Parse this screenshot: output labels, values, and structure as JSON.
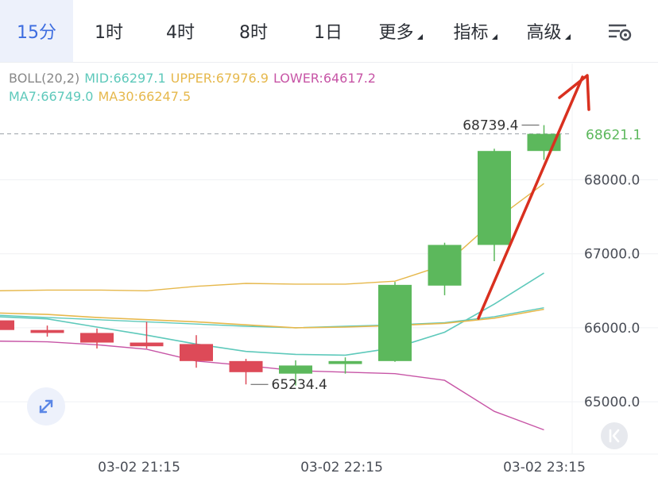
{
  "tabs": [
    {
      "label": "15分",
      "active": true
    },
    {
      "label": "1时"
    },
    {
      "label": "4时"
    },
    {
      "label": "8时"
    },
    {
      "label": "1日"
    },
    {
      "label": "更多",
      "dropdown": true
    },
    {
      "label": "指标",
      "dropdown": true
    },
    {
      "label": "高级",
      "dropdown": true
    }
  ],
  "settings_icon": "chart-settings-icon",
  "legend": {
    "boll_label": "BOLL(20,2)",
    "mid": "MID:66297.1",
    "upper": "UPPER:67976.9",
    "lower": "LOWER:64617.2",
    "ma7": "MA7:66749.0",
    "ma30": "MA30:66247.5"
  },
  "colors": {
    "up": "#5cb85c",
    "down": "#dd4a58",
    "boll_mid": "#5ec9bb",
    "boll_upper": "#e6b84c",
    "boll_lower": "#c755a6",
    "ma7": "#5ec9bb",
    "ma30": "#e6b84c",
    "arrow": "#d9301f",
    "active_tab": "#3d6de0"
  },
  "chart_data": {
    "type": "candlestick",
    "ylim": [
      64400,
      68950
    ],
    "y_ticks": [
      65000,
      66000,
      67000,
      68000
    ],
    "y_tick_labels": [
      "65000.0",
      "66000.0",
      "67000.0",
      "68000.0"
    ],
    "x_tick_labels": [
      "03-02 21:15",
      "03-02 22:15",
      "03-02 23:15"
    ],
    "candles": [
      {
        "open": 66100,
        "high": 66150,
        "low": 65950,
        "close": 65970
      },
      {
        "open": 65970,
        "high": 66030,
        "low": 65880,
        "close": 65930
      },
      {
        "open": 65930,
        "high": 65990,
        "low": 65720,
        "close": 65800
      },
      {
        "open": 65800,
        "high": 66080,
        "low": 65720,
        "close": 65750
      },
      {
        "open": 65780,
        "high": 65900,
        "low": 65460,
        "close": 65550
      },
      {
        "open": 65550,
        "high": 65580,
        "low": 65234.4,
        "close": 65400
      },
      {
        "open": 65380,
        "high": 65560,
        "low": 65220,
        "close": 65490
      },
      {
        "open": 65510,
        "high": 65600,
        "low": 65380,
        "close": 65550
      },
      {
        "open": 65550,
        "high": 66620,
        "low": 65540,
        "close": 66580
      },
      {
        "open": 66570,
        "high": 67150,
        "low": 66440,
        "close": 67120
      },
      {
        "open": 67120,
        "high": 68420,
        "low": 66900,
        "close": 68390
      },
      {
        "open": 68390,
        "high": 68739.4,
        "low": 68270,
        "close": 68621.1
      }
    ],
    "series": [
      {
        "name": "UPPER",
        "values": [
          66500,
          66510,
          66510,
          66500,
          66560,
          66600,
          66590,
          66590,
          66630,
          66850,
          67450,
          67950
        ]
      },
      {
        "name": "MID",
        "values": [
          66170,
          66140,
          66110,
          66080,
          66050,
          66020,
          66000,
          66020,
          66040,
          66070,
          66150,
          66270
        ]
      },
      {
        "name": "LOWER",
        "values": [
          65820,
          65810,
          65770,
          65710,
          65550,
          65490,
          65420,
          65400,
          65380,
          65290,
          64870,
          64620
        ]
      },
      {
        "name": "MA7",
        "values": [
          66150,
          66120,
          66010,
          65900,
          65780,
          65680,
          65640,
          65630,
          65730,
          65940,
          66320,
          66740
        ]
      },
      {
        "name": "MA30",
        "values": [
          66200,
          66180,
          66140,
          66110,
          66080,
          66040,
          66000,
          66010,
          66030,
          66060,
          66130,
          66250
        ]
      }
    ],
    "price_labels": {
      "high": "68739.4",
      "low": "65234.4",
      "last": "68621.1"
    },
    "last_price": 68621.1
  }
}
